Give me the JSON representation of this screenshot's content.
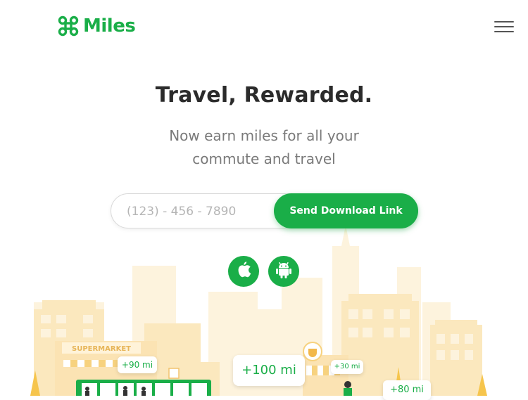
{
  "header": {
    "brand": "Miles",
    "menu_icon": "hamburger-menu-icon"
  },
  "hero": {
    "title": "Travel, Rewarded.",
    "subtitle_line1": "Now earn miles for all your",
    "subtitle_line2": "commute and travel"
  },
  "signup": {
    "phone_placeholder": "(123) - 456 - 7890",
    "phone_value": "",
    "send_label": "Send Download Link"
  },
  "stores": [
    {
      "icon": "apple-icon"
    },
    {
      "icon": "android-icon"
    }
  ],
  "illustration": {
    "supermarket_sign": "SUPERMARKET",
    "badges": [
      "+90 mi",
      "+100 mi",
      "+30 mi",
      "+80 mi"
    ]
  },
  "colors": {
    "brand_green": "#1aae48",
    "title_text": "#2b2b2b",
    "subtitle_text": "#7a7a7a",
    "building_light": "#fdf0d2",
    "building_mid": "#fae3b0"
  }
}
